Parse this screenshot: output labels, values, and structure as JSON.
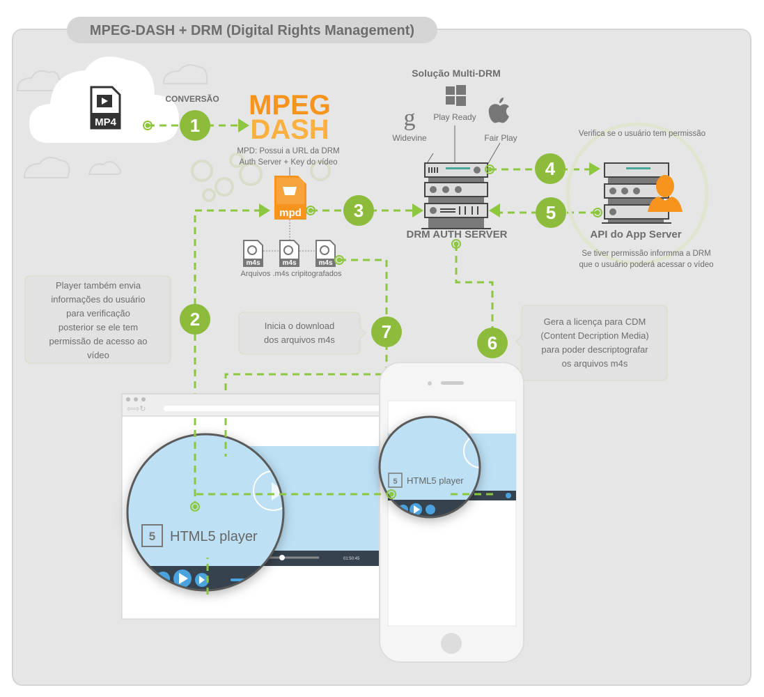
{
  "title": "MPEG-DASH + DRM (Digital Rights Management)",
  "source": {
    "file_label": "MP4",
    "conversion_label": "CONVERSÃO"
  },
  "mpeg_dash": {
    "logo_line1": "MPEG",
    "logo_line2": "DASH",
    "desc_line1": "MPD: Possui a URL da DRM",
    "desc_line2": "Auth Server + Key do vídeo",
    "file_label": "mpd"
  },
  "segments": {
    "file_label": "m4s",
    "caption": "Arquivos .m4s cripitografados"
  },
  "multi_drm": {
    "title": "Solução Multi-DRM",
    "providers": [
      "Widevine",
      "Play Ready",
      "Fair Play"
    ]
  },
  "drm_server": {
    "label": "DRM AUTH SERVER"
  },
  "app_server": {
    "label": "API do App Server",
    "top_note": "Verifica se o usuário tem permissão",
    "bottom_note_line1": "Se tiver permissão informma a DRM",
    "bottom_note_line2": "que o usuário poderá acessar o vídeo"
  },
  "steps": [
    "1",
    "2",
    "3",
    "4",
    "5",
    "6",
    "7"
  ],
  "bubbles": {
    "player_info": [
      "Player também envia",
      "informações do usuário",
      "para verificação",
      "posterior se ele tem",
      "permissão de acesso ao",
      "vídeo"
    ],
    "download": [
      "Inicia o download",
      "dos arquivos m4s"
    ],
    "license": [
      "Gera a licença para CDM",
      "(Content Decription Media)",
      "para poder descriptografar",
      "os arquivos m4s"
    ]
  },
  "player": {
    "label": "HTML5 player",
    "time": "01:50:45"
  },
  "colors": {
    "accent_green": "#8dbb3b",
    "orange": "#f7941d",
    "panel": "#e6e6e6",
    "video_blue": "#bde0f5",
    "player_bar": "#36424d"
  }
}
